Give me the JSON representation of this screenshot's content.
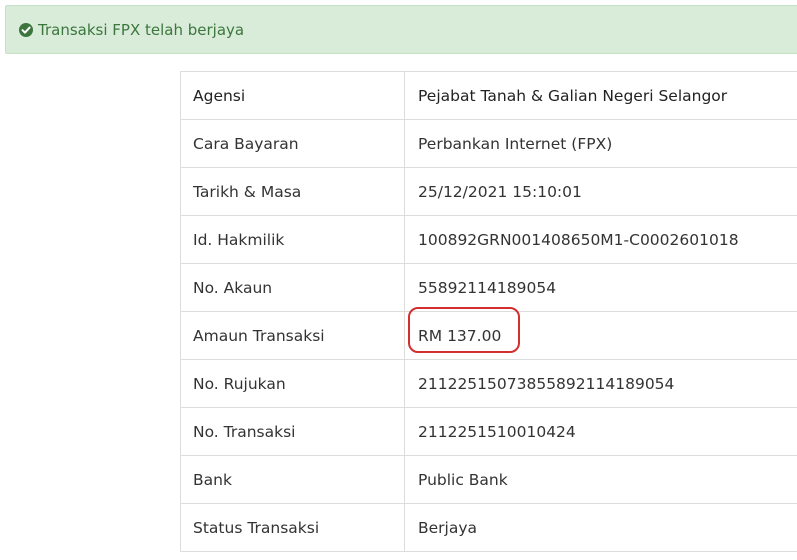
{
  "alert": {
    "message": "Transaksi FPX telah berjaya",
    "icon": "check-circle-icon",
    "color": "#3c763d",
    "background": "#d9ecd9"
  },
  "details": {
    "rows": [
      {
        "label": "Agensi",
        "value": "Pejabat Tanah & Galian Negeri Selangor"
      },
      {
        "label": "Cara Bayaran",
        "value": "Perbankan Internet (FPX)"
      },
      {
        "label": "Tarikh & Masa",
        "value": "25/12/2021 15:10:01"
      },
      {
        "label": "Id. Hakmilik",
        "value": "100892GRN001408650M1-C0002601018"
      },
      {
        "label": "No. Akaun",
        "value": "55892114189054"
      },
      {
        "label": "Amaun Transaksi",
        "value": "RM 137.00"
      },
      {
        "label": "No. Rujukan",
        "value": "21122515073855892114189054"
      },
      {
        "label": "No. Transaksi",
        "value": "2112251510010424"
      },
      {
        "label": "Bank",
        "value": "Public Bank"
      },
      {
        "label": "Status Transaksi",
        "value": "Berjaya"
      }
    ]
  },
  "annotation": {
    "color": "#d32f2f"
  }
}
